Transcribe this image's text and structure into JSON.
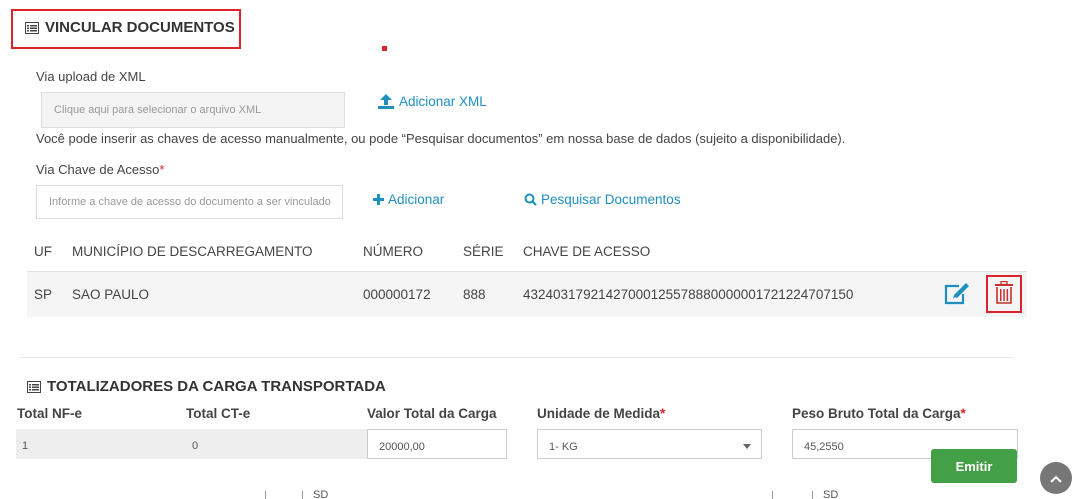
{
  "vincular": {
    "title": "VINCULAR DOCUMENTOS",
    "xml_label": "Via upload de XML",
    "xml_placeholder": "Clique aqui para selecionar o arquivo XML",
    "add_xml": "Adicionar XML",
    "help_text": "Você pode inserir as chaves de acesso manualmente, ou pode “Pesquisar documentos” em nossa base de dados (sujeito a disponibilidade).",
    "chave_label": "Via Chave de Acesso",
    "required_mark": "*",
    "chave_placeholder": "Informe a chave de acesso do documento a ser vinculado",
    "add_label": "Adicionar",
    "search_label": "Pesquisar Documentos"
  },
  "table": {
    "headers": [
      "UF",
      "MUNICÍPIO DE DESCARREGAMENTO",
      "NÚMERO",
      "SÉRIE",
      "CHAVE DE ACESSO"
    ],
    "rows": [
      [
        "SP",
        "SAO PAULO",
        "000000172",
        "888",
        "43240317921427000125578880000001721224707150"
      ]
    ]
  },
  "totalizadores": {
    "title": "TOTALIZADORES DA CARGA TRANSPORTADA",
    "fields": [
      {
        "label": "Total NF-e",
        "value": "1"
      },
      {
        "label": "Total CT-e",
        "value": "0"
      },
      {
        "label": "Valor Total da Carga",
        "value": "20000,00"
      },
      {
        "label": "Unidade de Medida",
        "value": "1- KG"
      },
      {
        "label": "Peso Bruto Total da Carga",
        "value": "45,2550"
      }
    ]
  },
  "footer": {
    "emitir": "Emitir",
    "fragment_left": "SD",
    "fragment_right": "SD"
  },
  "icons": {
    "list": "list-icon",
    "upload": "upload-icon",
    "plus": "plus-icon",
    "search": "search-icon",
    "edit": "edit-icon",
    "trash": "trash-icon",
    "chevron_up": "chevron-up-icon"
  },
  "colors": {
    "link": "#1f8fc0",
    "highlight": "#d9232d",
    "primary_button": "#43a047"
  }
}
